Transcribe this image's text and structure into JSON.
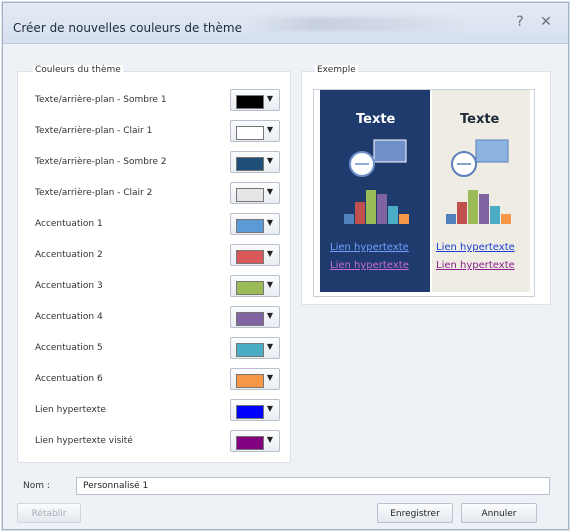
{
  "window": {
    "title": "Créer de nouvelles couleurs de thème",
    "help_symbol": "?",
    "close_symbol": "✕"
  },
  "theme_colors": {
    "label": "Couleurs du thème",
    "rows": [
      {
        "label": "Texte/arrière-plan - Sombre 1",
        "color": "#000000"
      },
      {
        "label": "Texte/arrière-plan - Clair 1",
        "color": "#ffffff"
      },
      {
        "label": "Texte/arrière-plan - Sombre 2",
        "color": "#1f4e79"
      },
      {
        "label": "Texte/arrière-plan - Clair 2",
        "color": "#e7e6e6"
      },
      {
        "label": "Accentuation 1",
        "color": "#5b9bd5"
      },
      {
        "label": "Accentuation 2",
        "color": "#d9595b"
      },
      {
        "label": "Accentuation 3",
        "color": "#9bbb59"
      },
      {
        "label": "Accentuation 4",
        "color": "#8064a2"
      },
      {
        "label": "Accentuation 5",
        "color": "#4bacc6"
      },
      {
        "label": "Accentuation 6",
        "color": "#f79646"
      },
      {
        "label": "Lien hypertexte",
        "color": "#0000ff"
      },
      {
        "label": "Lien hypertexte visité",
        "color": "#800080"
      }
    ]
  },
  "example": {
    "label": "Exemple",
    "dark": {
      "title": "Texte",
      "link": "Lien hypertexte",
      "visited_link": "Lien hypertexte",
      "bg": "#1f3b6e"
    },
    "light": {
      "title": "Texte",
      "link": "Lien hypertexte",
      "visited_link": "Lien hypertexte",
      "bg": "#efece4"
    },
    "bar_colors": [
      "#4f81bd",
      "#c0504d",
      "#9bbb59",
      "#8064a2",
      "#4bacc6",
      "#f79646"
    ]
  },
  "footer": {
    "name_label": "Nom :",
    "name_value": "Personnalisé 1",
    "reset_label": "Rétablir",
    "save_label": "Enregistrer",
    "cancel_label": "Annuler"
  }
}
